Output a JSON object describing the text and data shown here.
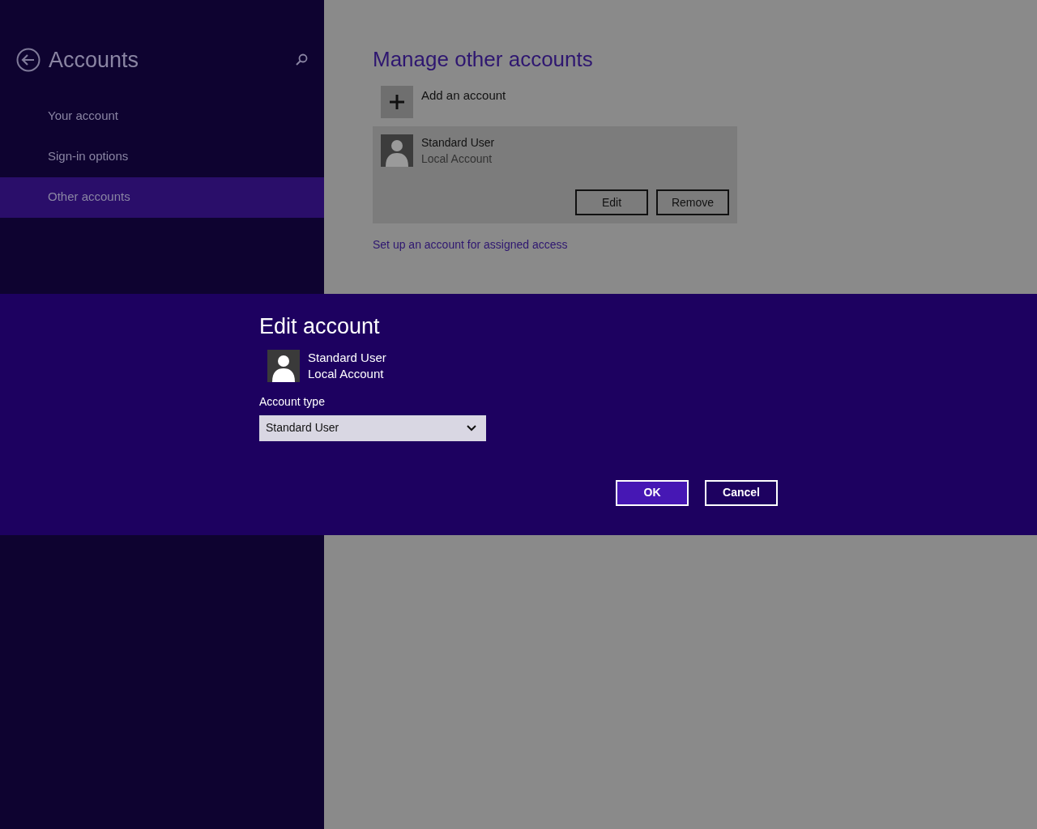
{
  "sidebar": {
    "title": "Accounts",
    "items": [
      {
        "label": "Your account",
        "selected": false
      },
      {
        "label": "Sign-in options",
        "selected": false
      },
      {
        "label": "Other accounts",
        "selected": true
      }
    ]
  },
  "main": {
    "heading": "Manage other accounts",
    "add_account": "Add an account",
    "account": {
      "name": "Standard User",
      "type": "Local Account"
    },
    "buttons": [
      "Edit",
      "Remove"
    ],
    "link": "Set up an account for assigned access"
  },
  "dialog": {
    "title": "Edit account",
    "account": {
      "name": "Standard User",
      "type": "Local Account"
    },
    "field_label": "Account type",
    "select_value": "Standard User",
    "buttons": [
      {
        "label": "OK",
        "kind": "primary"
      },
      {
        "label": "Cancel",
        "kind": "secondary"
      }
    ]
  }
}
